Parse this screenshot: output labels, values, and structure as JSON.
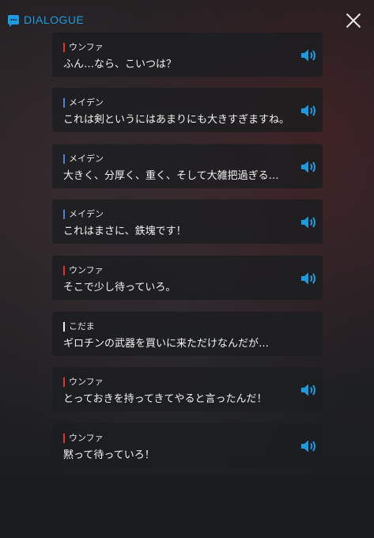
{
  "header": {
    "title": "DIALOGUE",
    "accent": "#1e9be0"
  },
  "entries": [
    {
      "speaker": "ウンファ",
      "text": "ふん…なら、こいつは？",
      "bar_color": "#e0352b",
      "icon": "speaker-volume-icon"
    },
    {
      "speaker": "メイデン",
      "text": "これは剣というにはあまりにも大きすぎますね。",
      "bar_color": "#4f7fd0",
      "icon": "speaker-volume-icon"
    },
    {
      "speaker": "メイデン",
      "text": "大きく、分厚く、重く、そして大雑把過ぎる…",
      "bar_color": "#4f7fd0",
      "icon": "speaker-volume-icon"
    },
    {
      "speaker": "メイデン",
      "text": "これはまさに、鉄塊です！",
      "bar_color": "#4f7fd0",
      "icon": "speaker-volume-icon"
    },
    {
      "speaker": "ウンファ",
      "text": "そこで少し待っていろ。",
      "bar_color": "#e0352b",
      "icon": "speaker-volume-icon"
    },
    {
      "speaker": "こだま",
      "text": "ギロチンの武器を買いに来ただけなんだが…",
      "bar_color": "#f0f0f0",
      "icon": ""
    },
    {
      "speaker": "ウンファ",
      "text": "とっておきを持ってきてやると言ったんだ！",
      "bar_color": "#e0352b",
      "icon": "speaker-volume-icon"
    },
    {
      "speaker": "ウンファ",
      "text": "黙って待っていろ！",
      "bar_color": "#e0352b",
      "icon": "speaker-volume-icon"
    }
  ]
}
